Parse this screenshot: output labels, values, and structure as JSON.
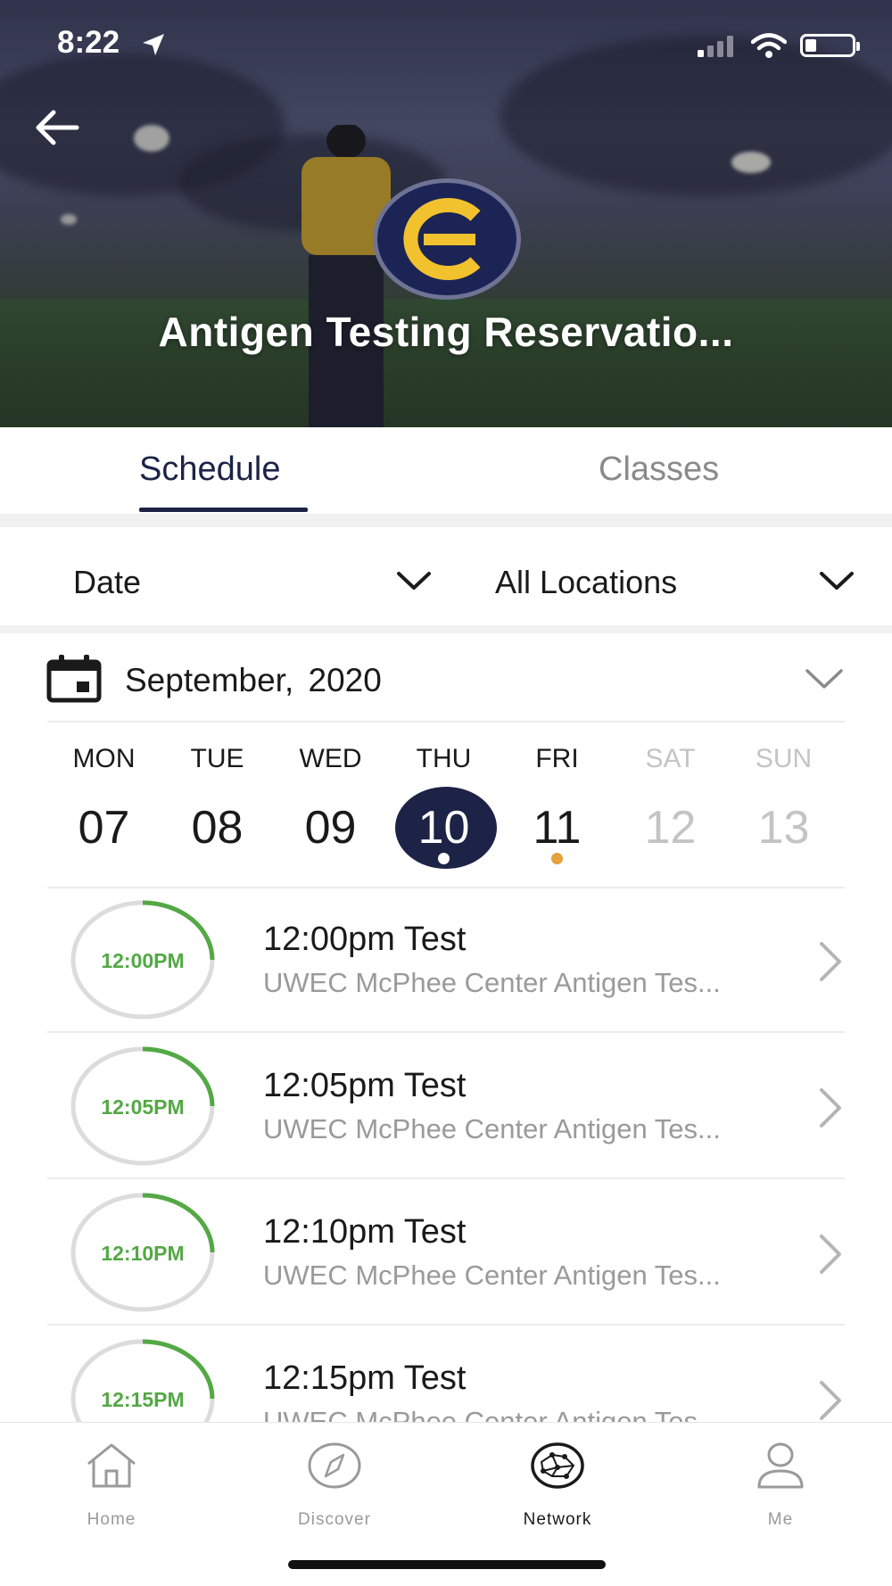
{
  "status_bar": {
    "time": "8:22"
  },
  "hero": {
    "title": "Antigen Testing Reservatio..."
  },
  "tabs": [
    {
      "label": "Schedule",
      "active": true
    },
    {
      "label": "Classes",
      "active": false
    }
  ],
  "filters": {
    "date_label": "Date",
    "location_label": "All Locations"
  },
  "calendar": {
    "month_label": "September,  2020",
    "days": [
      {
        "dow": "MON",
        "num": "07",
        "enabled": true
      },
      {
        "dow": "TUE",
        "num": "08",
        "enabled": true
      },
      {
        "dow": "WED",
        "num": "09",
        "enabled": true
      },
      {
        "dow": "THU",
        "num": "10",
        "enabled": true,
        "selected": true,
        "dot": "#ffffff"
      },
      {
        "dow": "FRI",
        "num": "11",
        "enabled": true,
        "dot": "#e5a13c"
      },
      {
        "dow": "SAT",
        "num": "12",
        "enabled": false
      },
      {
        "dow": "SUN",
        "num": "13",
        "enabled": false
      }
    ]
  },
  "sessions": [
    {
      "time": "12:00PM",
      "title": "12:00pm Test",
      "location": "UWEC McPhee Center Antigen Tes..."
    },
    {
      "time": "12:05PM",
      "title": "12:05pm Test",
      "location": "UWEC McPhee Center Antigen Tes..."
    },
    {
      "time": "12:10PM",
      "title": "12:10pm Test",
      "location": "UWEC McPhee Center Antigen Tes..."
    },
    {
      "time": "12:15PM",
      "title": "12:15pm Test",
      "location": "UWEC McPhee Center Antigen Tes..."
    }
  ],
  "bottom_nav": [
    {
      "label": "Home",
      "icon": "home-icon",
      "active": false
    },
    {
      "label": "Discover",
      "icon": "compass-icon",
      "active": false
    },
    {
      "label": "Network",
      "icon": "network-icon",
      "active": true
    },
    {
      "label": "Me",
      "icon": "person-icon",
      "active": false
    }
  ],
  "colors": {
    "primary": "#1c2346",
    "accent_green": "#54a845",
    "event_dot": "#e5a13c",
    "muted": "#9a9a9a"
  }
}
